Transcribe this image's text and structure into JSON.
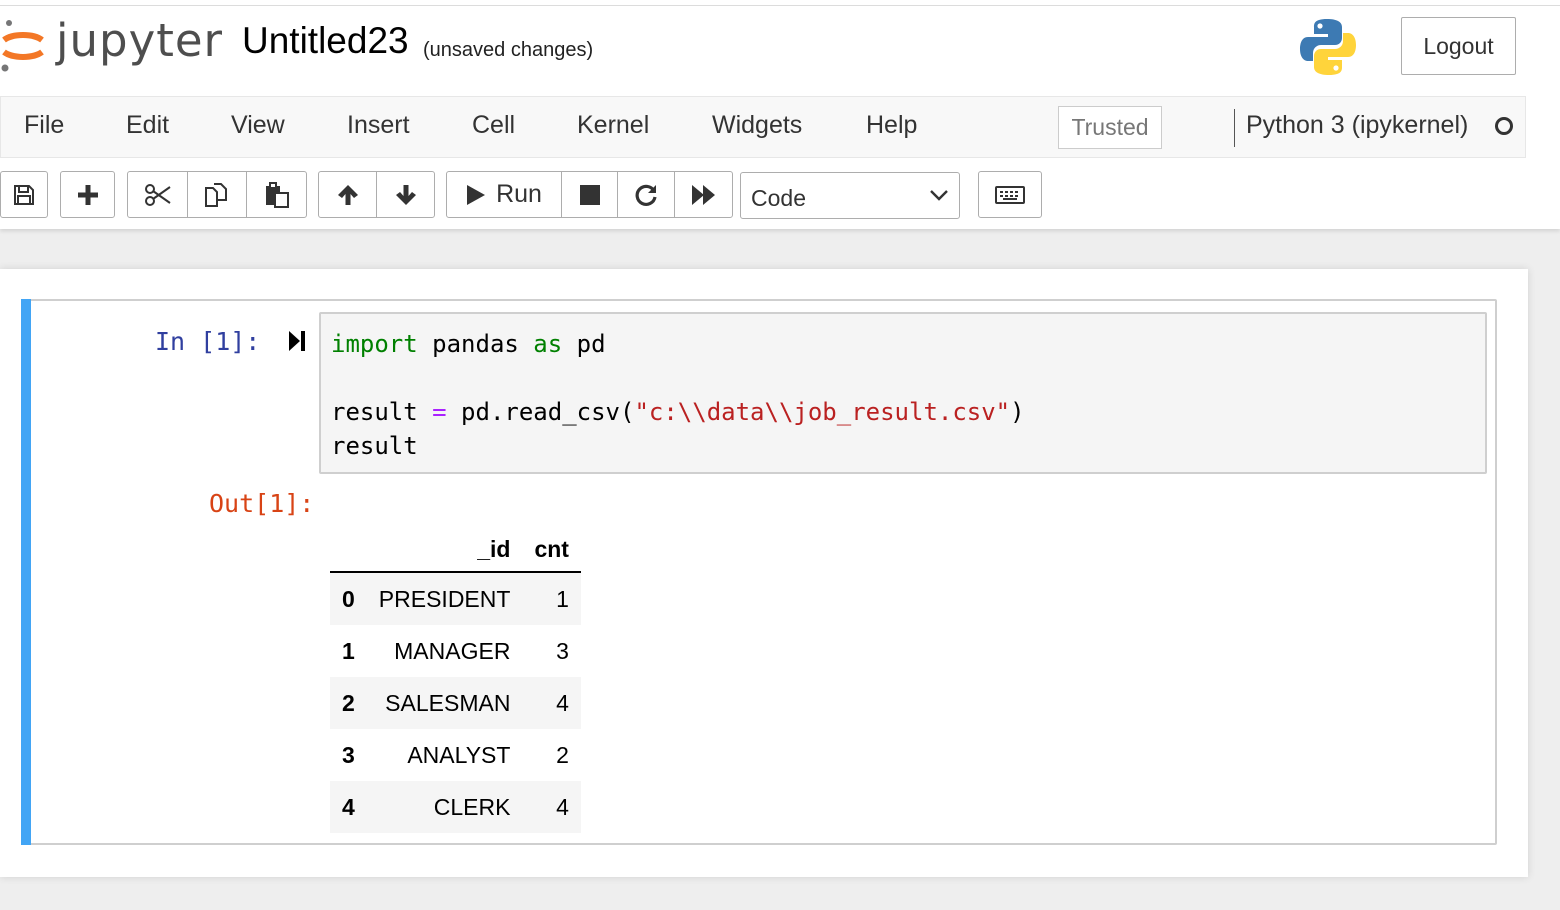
{
  "header": {
    "logo_text": "jupyter",
    "notebook_name": "Untitled23",
    "save_status": "(unsaved changes)",
    "logout_label": "Logout"
  },
  "menubar": {
    "items": [
      "File",
      "Edit",
      "View",
      "Insert",
      "Cell",
      "Kernel",
      "Widgets",
      "Help"
    ],
    "trusted_label": "Trusted",
    "kernel_name": "Python 3 (ipykernel)"
  },
  "toolbar": {
    "icons": [
      "save-icon",
      "plus-icon",
      "scissors-icon",
      "copy-icon",
      "paste-icon",
      "arrow-up-icon",
      "arrow-down-icon",
      "play-icon",
      "stop-icon",
      "restart-icon",
      "fast-forward-icon",
      "keyboard-icon"
    ],
    "run_label": "Run",
    "cell_type": "Code"
  },
  "cell": {
    "in_prompt": "In [1]:",
    "code": [
      [
        [
          "kw",
          "import"
        ],
        [
          "",
          " pandas "
        ],
        [
          "kw",
          "as"
        ],
        [
          "",
          " pd"
        ]
      ],
      [],
      [
        [
          "",
          "result "
        ],
        [
          "op",
          "="
        ],
        [
          "",
          " pd.read_csv("
        ],
        [
          "str",
          "\"c:\\\\data\\\\job_result.csv\""
        ],
        [
          "",
          ")"
        ]
      ],
      [
        [
          "",
          "result"
        ]
      ]
    ],
    "out_prompt": "Out[1]:",
    "output_table": {
      "columns": [
        "",
        "_id",
        "cnt"
      ],
      "rows": [
        [
          "0",
          "PRESIDENT",
          "1"
        ],
        [
          "1",
          "MANAGER",
          "3"
        ],
        [
          "2",
          "SALESMAN",
          "4"
        ],
        [
          "3",
          "ANALYST",
          "2"
        ],
        [
          "4",
          "CLERK",
          "4"
        ]
      ]
    }
  },
  "colors": {
    "accent": "#f37726",
    "selected_cell_bar": "#42a5f5",
    "in_prompt": "#303f9f",
    "out_prompt": "#d84315"
  }
}
